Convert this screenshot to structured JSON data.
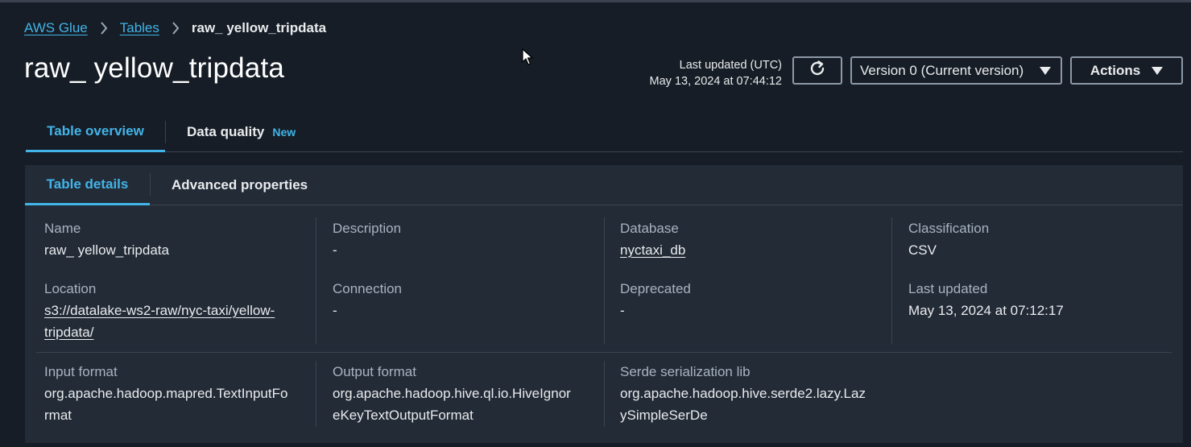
{
  "breadcrumb": {
    "items": [
      "AWS Glue",
      "Tables"
    ],
    "current": "raw_ yellow_tripdata"
  },
  "header": {
    "title": "raw_ yellow_tripdata",
    "last_updated_label": "Last updated (UTC)",
    "last_updated_value": "May 13, 2024 at 07:44:12",
    "refresh_icon": "refresh-icon",
    "version_select": "Version 0 (Current version)",
    "actions_label": "Actions"
  },
  "tabs": {
    "overview": "Table overview",
    "data_quality": "Data quality",
    "data_quality_badge": "New"
  },
  "subtabs": {
    "details": "Table details",
    "advanced": "Advanced properties"
  },
  "details": {
    "name": {
      "label": "Name",
      "value": "raw_ yellow_tripdata"
    },
    "description": {
      "label": "Description",
      "value": "-"
    },
    "database": {
      "label": "Database",
      "value": "nyctaxi_db"
    },
    "classification": {
      "label": "Classification",
      "value": "CSV"
    },
    "location": {
      "label": "Location",
      "value_line1": "s3://datalake-ws2-raw/nyc-taxi/yellow-",
      "value_line2": "tripdata/"
    },
    "connection": {
      "label": "Connection",
      "value": "-"
    },
    "deprecated": {
      "label": "Deprecated",
      "value": "-"
    },
    "last_updated": {
      "label": "Last updated",
      "value": "May 13, 2024 at 07:12:17"
    },
    "input_format": {
      "label": "Input format",
      "value_line1": "org.apache.hadoop.mapred.TextInputFo",
      "value_line2": "rmat"
    },
    "output_format": {
      "label": "Output format",
      "value_line1": "org.apache.hadoop.hive.ql.io.HiveIgnor",
      "value_line2": "eKeyTextOutputFormat"
    },
    "serde": {
      "label": "Serde serialization lib",
      "value_line1": "org.apache.hadoop.hive.serde2.lazy.Laz",
      "value_line2": "ySimpleSerDe"
    }
  },
  "colors": {
    "background": "#161d26",
    "panel": "#232b37",
    "accent": "#42b4e8",
    "border": "#3b4350"
  }
}
